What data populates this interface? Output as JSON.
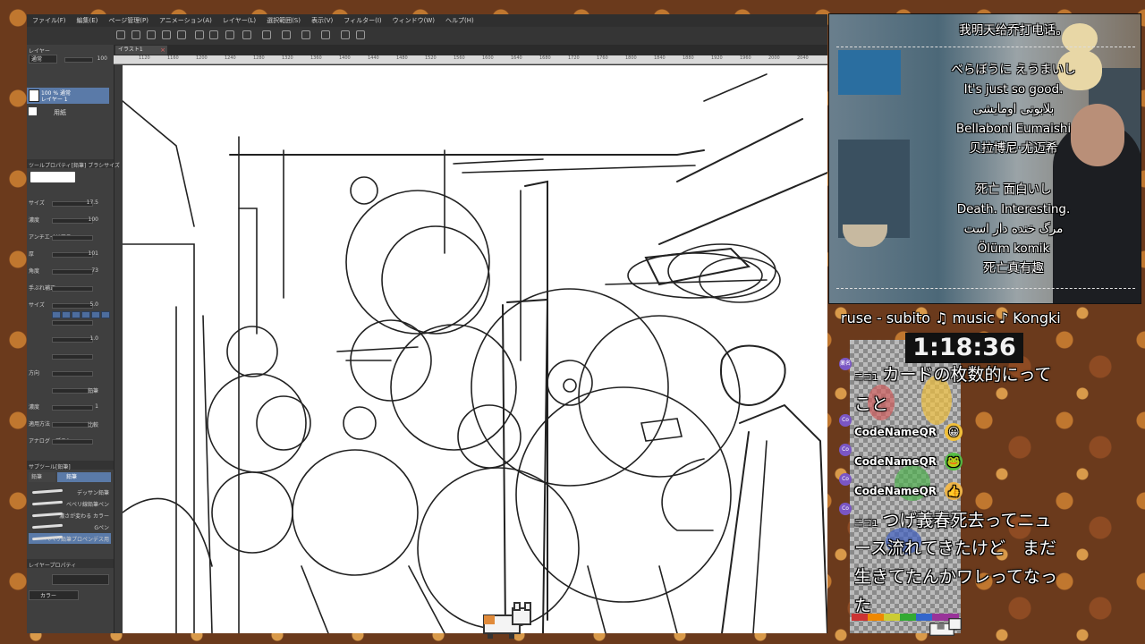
{
  "app": {
    "menu": [
      "ファイル(F)",
      "編集(E)",
      "ページ管理(P)",
      "アニメーション(A)",
      "レイヤー(L)",
      "選択範囲(S)",
      "表示(V)",
      "フィルター(I)",
      "ウィンドウ(W)",
      "ヘルプ(H)"
    ],
    "doc_tab": "イラスト1",
    "ruler_numbers": [
      "1120",
      "1160",
      "1200",
      "1240",
      "1280",
      "1320",
      "1360",
      "1400",
      "1440",
      "1480",
      "1520",
      "1560",
      "1600",
      "1640",
      "1680",
      "1720",
      "1760",
      "1800",
      "1840",
      "1880",
      "1920",
      "1960",
      "2000",
      "2040"
    ],
    "layer": {
      "panel_title": "レイヤー",
      "blend_mode": "通常",
      "opacity": "100",
      "layer_name_line1": "100 % 通常",
      "layer_name_line2": "レイヤー 1",
      "paper_label": "用紙"
    },
    "tool_property": {
      "title": "ツールプロパティ[鉛筆] ブラシサイズ",
      "brush": "鉛筆",
      "rows": [
        {
          "label": "サイズ",
          "value": "17.5"
        },
        {
          "label": "濃度",
          "value": "100"
        },
        {
          "label": "アンチエイリアス",
          "value": ""
        },
        {
          "label": "厚",
          "value": "101"
        },
        {
          "label": "角度",
          "value": "73"
        },
        {
          "label": "手ぶれ補正",
          "value": ""
        },
        {
          "label": "サイズ",
          "value": "5.0"
        },
        {
          "label": "",
          "value": ""
        },
        {
          "label": "",
          "value": "1.0"
        },
        {
          "label": "",
          "value": ""
        },
        {
          "label": "方向",
          "value": ""
        },
        {
          "label": "",
          "value": "鉛筆"
        },
        {
          "label": "濃度",
          "value": "1"
        },
        {
          "label": "適用方法",
          "value": "比較"
        },
        {
          "label": "アナログ・ブラシ",
          "value": ""
        }
      ]
    },
    "sub_tool": {
      "title": "サブツール[鉛筆]",
      "tabs": [
        "鉛筆",
        "鉛筆"
      ],
      "brushes": [
        "デッサン鉛筆",
        "ベベリ線鉛筆ペン",
        "濃さが変わる カラー",
        "Gペン",
        "ベベリ鉛筆プロペンデス用"
      ]
    },
    "layer_property": {
      "title": "レイヤープロパティ",
      "color_label": "カラー"
    }
  },
  "stream": {
    "subtitles": [
      "我明天给乔打电话。",
      "べらぼうに えうまいし",
      "It's just so good.",
      "بلابونی اومایشی",
      "Bellaboni Eumaishi",
      "贝拉博尼·尤迈希",
      "死亡 面白いし",
      "Death. Interesting.",
      "مرگ خنده دار است",
      "Ölüm komik",
      "死亡真有趣"
    ],
    "music_ticker": "ruse - subito    ♫ music ♪ Kongki",
    "timer": "1:18:36"
  },
  "chat": {
    "messages": [
      {
        "name": "ニコ1",
        "text": "カードの枚数的にって",
        "cont": "こと"
      },
      {
        "name": "CodeNameQR",
        "emoji": "😀"
      },
      {
        "name": "CodeNameQR",
        "emoji": "🐸"
      },
      {
        "name": "CodeNameQR",
        "emoji": "👍"
      },
      {
        "name": "ニコ1",
        "text": "つげ義春死去ってニュ",
        "cont": "ース流れてきたけど　まだ",
        "cont2": "生きてたんかワレってなっ",
        "cont3": "た"
      }
    ],
    "side_icons": [
      "薬名",
      "Co",
      "Co",
      "Co",
      "Co"
    ]
  },
  "colors": {
    "accent_blue": "#5a7aa8",
    "app_bg": "#3b3b3b",
    "timer_bg": "#111111"
  }
}
